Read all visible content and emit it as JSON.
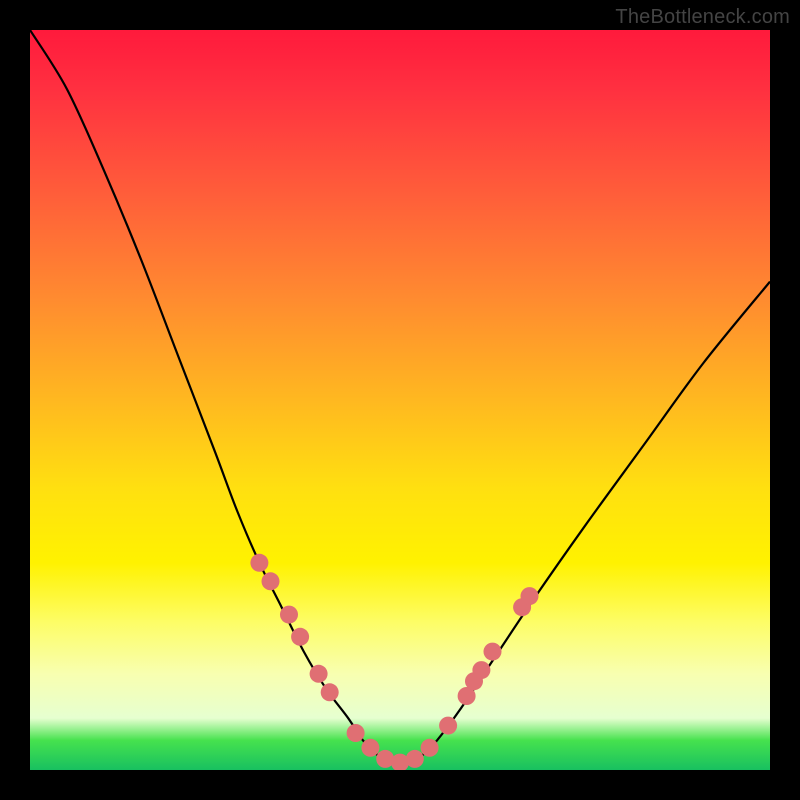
{
  "watermark": "TheBottleneck.com",
  "chart_data": {
    "type": "line",
    "title": "",
    "xlabel": "",
    "ylabel": "",
    "xlim": [
      0,
      100
    ],
    "ylim": [
      0,
      100
    ],
    "series": [
      {
        "name": "bottleneck-curve",
        "x": [
          0,
          5,
          10,
          15,
          20,
          25,
          28,
          31,
          34,
          37,
          40,
          43,
          45,
          47,
          49,
          51,
          53,
          55,
          58,
          62,
          68,
          75,
          83,
          91,
          100
        ],
        "values": [
          100,
          92,
          81,
          69,
          56,
          43,
          35,
          28,
          22,
          16,
          11,
          7,
          4,
          2,
          1,
          1,
          2,
          4,
          8,
          14,
          23,
          33,
          44,
          55,
          66
        ]
      }
    ],
    "markers": [
      {
        "x": 31.0,
        "y": 28.0
      },
      {
        "x": 32.5,
        "y": 25.5
      },
      {
        "x": 35.0,
        "y": 21.0
      },
      {
        "x": 36.5,
        "y": 18.0
      },
      {
        "x": 39.0,
        "y": 13.0
      },
      {
        "x": 40.5,
        "y": 10.5
      },
      {
        "x": 44.0,
        "y": 5.0
      },
      {
        "x": 46.0,
        "y": 3.0
      },
      {
        "x": 48.0,
        "y": 1.5
      },
      {
        "x": 50.0,
        "y": 1.0
      },
      {
        "x": 52.0,
        "y": 1.5
      },
      {
        "x": 54.0,
        "y": 3.0
      },
      {
        "x": 56.5,
        "y": 6.0
      },
      {
        "x": 59.0,
        "y": 10.0
      },
      {
        "x": 60.0,
        "y": 12.0
      },
      {
        "x": 61.0,
        "y": 13.5
      },
      {
        "x": 62.5,
        "y": 16.0
      },
      {
        "x": 66.5,
        "y": 22.0
      },
      {
        "x": 67.5,
        "y": 23.5
      }
    ],
    "marker_color": "#e06f73",
    "curve_color": "#000000",
    "background_gradient": [
      "#ff1a3c",
      "#ffe010",
      "#18c060"
    ]
  }
}
